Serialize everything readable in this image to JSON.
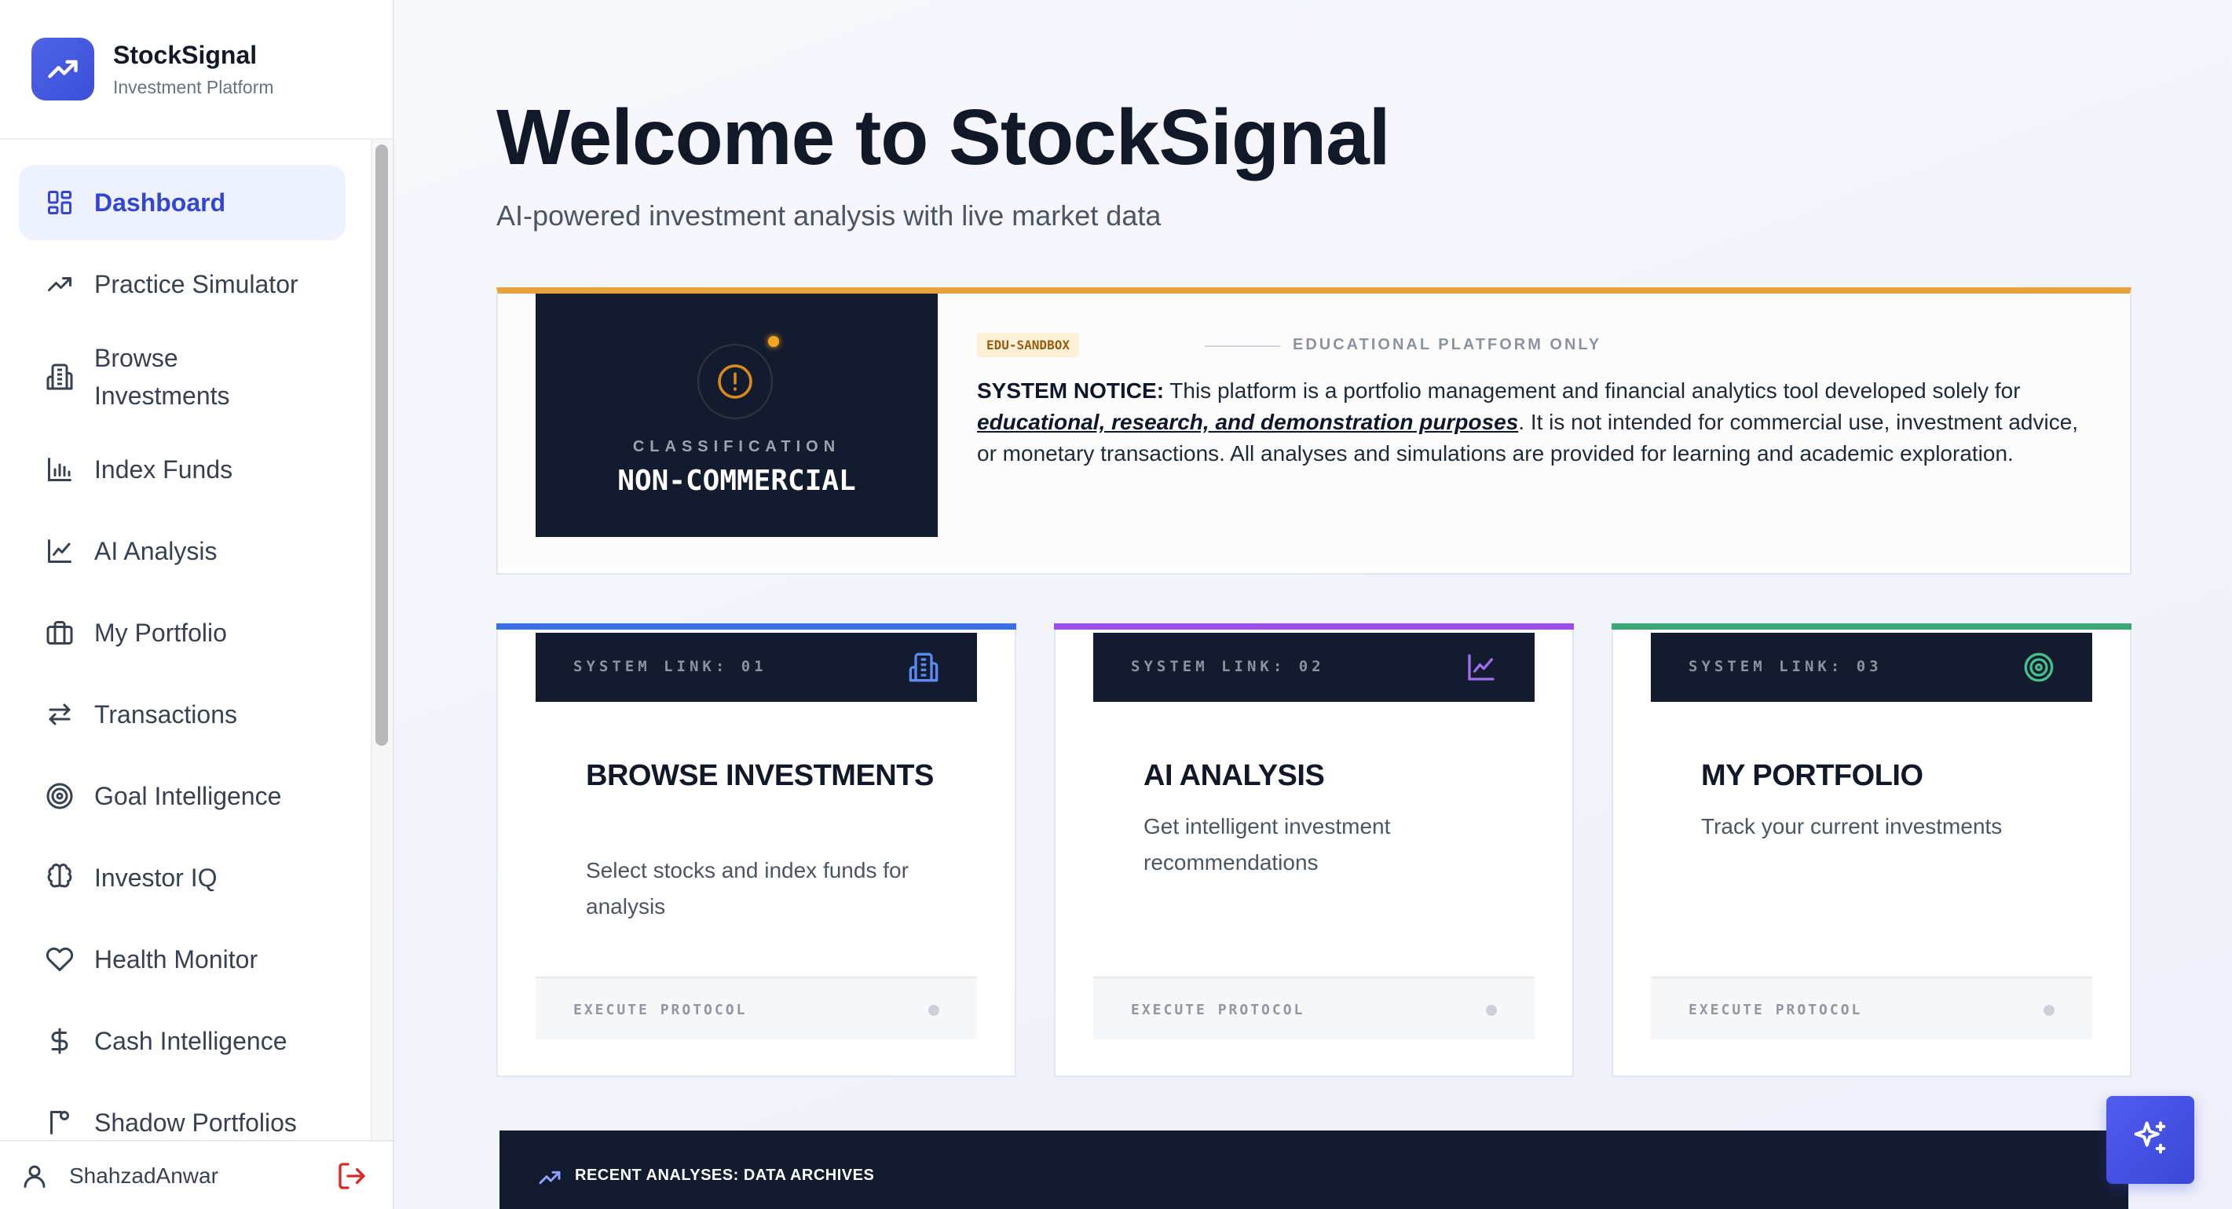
{
  "brand": {
    "name": "StockSignal",
    "subtitle": "Investment Platform"
  },
  "sidebar": {
    "items": [
      {
        "label": "Dashboard",
        "icon": "dashboard-grid-icon",
        "active": true
      },
      {
        "label": "Practice Simulator",
        "icon": "trending-up-icon"
      },
      {
        "label": "Browse Investments",
        "icon": "building-icon"
      },
      {
        "label": "Index Funds",
        "icon": "bar-chart-icon"
      },
      {
        "label": "AI Analysis",
        "icon": "line-chart-icon"
      },
      {
        "label": "My Portfolio",
        "icon": "briefcase-icon"
      },
      {
        "label": "Transactions",
        "icon": "swap-arrows-icon"
      },
      {
        "label": "Goal Intelligence",
        "icon": "target-icon"
      },
      {
        "label": "Investor IQ",
        "icon": "brain-icon"
      },
      {
        "label": "Health Monitor",
        "icon": "heart-icon"
      },
      {
        "label": "Cash Intelligence",
        "icon": "dollar-icon"
      },
      {
        "label": "Shadow Portfolios",
        "icon": "shadow-icon"
      }
    ]
  },
  "user": {
    "name": "ShahzadAnwar"
  },
  "main": {
    "title": "Welcome to StockSignal",
    "subtitle": "AI-powered investment analysis with live market data"
  },
  "notice": {
    "classification_label": "CLASSIFICATION",
    "classification_value": "NON-COMMERCIAL",
    "badge": "EDU-SANDBOX",
    "platform_label": "EDUCATIONAL PLATFORM ONLY",
    "heading": "SYSTEM NOTICE:",
    "text_1": " This platform is a portfolio management and financial analytics tool developed solely for ",
    "emphasis": "educational, research, and demonstration purposes",
    "text_2": ". It is not intended for commercial use, investment advice, or monetary transactions. All analyses and simulations are provided for learning and academic exploration.",
    "accent_color": "#e8a23c"
  },
  "cards": [
    {
      "link": "SYSTEM LINK: 01",
      "title": "BROWSE INVESTMENTS",
      "description": "Select stocks and index funds for analysis",
      "footer": "EXECUTE PROTOCOL",
      "accent": "#3b6fe8",
      "icon": "building-icon"
    },
    {
      "link": "SYSTEM LINK: 02",
      "title": "AI ANALYSIS",
      "description": "Get intelligent investment recommendations",
      "footer": "EXECUTE PROTOCOL",
      "accent": "#9b4fe8",
      "icon": "line-chart-icon"
    },
    {
      "link": "SYSTEM LINK: 03",
      "title": "MY PORTFOLIO",
      "description": "Track your current investments",
      "footer": "EXECUTE PROTOCOL",
      "accent": "#3aa876",
      "icon": "target-icon"
    }
  ],
  "recent": {
    "label": "RECENT ANALYSES: DATA ARCHIVES"
  },
  "fab": {
    "icon": "sparkles-icon"
  }
}
